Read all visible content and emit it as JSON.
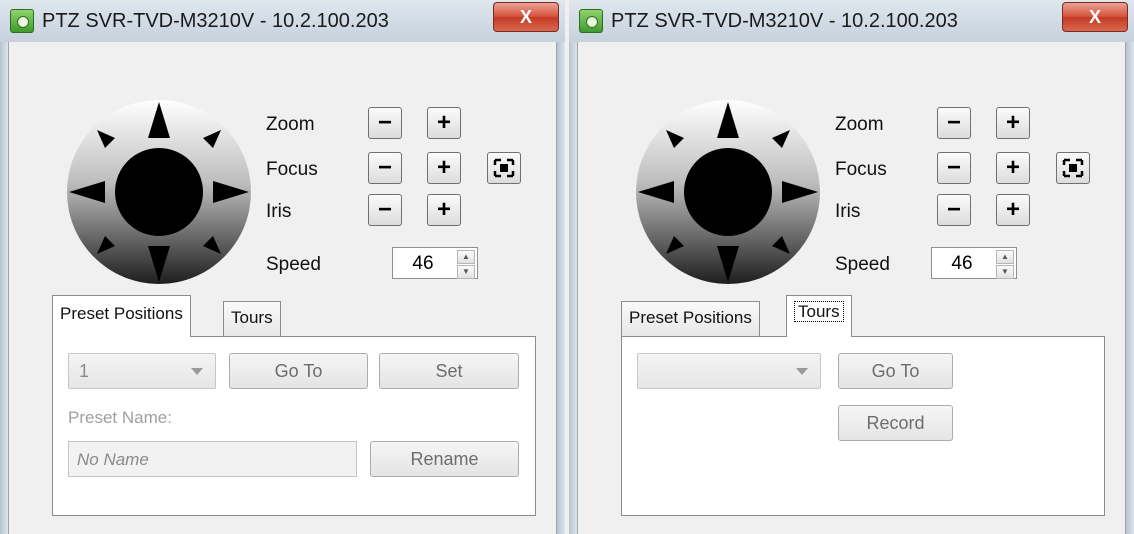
{
  "windows": [
    {
      "title": "PTZ  SVR-TVD-M3210V - 10.2.100.203",
      "close_label": "X",
      "controls": {
        "zoom_label": "Zoom",
        "focus_label": "Focus",
        "iris_label": "Iris",
        "speed_label": "Speed",
        "minus": "−",
        "plus": "+",
        "speed_value": "46"
      },
      "tabs": [
        "Preset Positions",
        "Tours"
      ],
      "active_tab": "Preset Positions",
      "preset": {
        "selected": "1",
        "goto_label": "Go To",
        "set_label": "Set",
        "name_label": "Preset Name:",
        "name_value": "No Name",
        "rename_label": "Rename"
      }
    },
    {
      "title": "PTZ  SVR-TVD-M3210V - 10.2.100.203",
      "close_label": "X",
      "controls": {
        "zoom_label": "Zoom",
        "focus_label": "Focus",
        "iris_label": "Iris",
        "speed_label": "Speed",
        "minus": "−",
        "plus": "+",
        "speed_value": "46"
      },
      "tabs": [
        "Preset Positions",
        "Tours"
      ],
      "active_tab": "Tours",
      "tours": {
        "selected": "",
        "goto_label": "Go To",
        "record_label": "Record"
      }
    }
  ],
  "icons": {
    "app": "camera-app-icon",
    "close": "close-icon",
    "joystick": "ptz-direction-joystick",
    "autofocus": "auto-focus-icon"
  }
}
